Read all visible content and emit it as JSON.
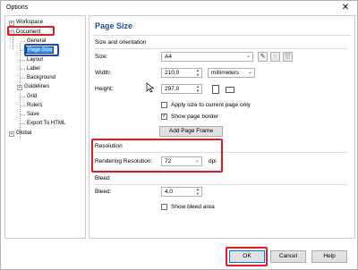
{
  "window": {
    "title": "Options",
    "close_glyph": "✕"
  },
  "tree": {
    "items": [
      {
        "label": "Workspace",
        "expander": "+"
      },
      {
        "label": "Document",
        "expander": "−"
      },
      {
        "label": "General"
      },
      {
        "label": "Page Size"
      },
      {
        "label": "Layout"
      },
      {
        "label": "Label"
      },
      {
        "label": "Background"
      },
      {
        "label": "Guidelines",
        "expander": "+"
      },
      {
        "label": "Grid"
      },
      {
        "label": "Rulers"
      },
      {
        "label": "Save"
      },
      {
        "label": "Export To HTML"
      },
      {
        "label": "Global",
        "expander": "+"
      }
    ]
  },
  "page": {
    "title": "Page Size",
    "size_orientation": {
      "section_label": "Size and orientation",
      "size_label": "Size:",
      "size_value": "A4",
      "width_label": "Width:",
      "width_value": "210,0",
      "units_value": "millimeters",
      "height_label": "Height:",
      "height_value": "297,0",
      "apply_current_label": "Apply size to current page only",
      "apply_current_checked": false,
      "show_border_label": "Show page border",
      "show_border_checked": true,
      "add_frame_label": "Add Page Frame"
    },
    "resolution": {
      "section_label": "Resolution",
      "rendering_label": "Rendering Resolution:",
      "rendering_value": "72",
      "unit": "dpi"
    },
    "bleed": {
      "section_label": "Bleed",
      "bleed_label": "Bleed:",
      "bleed_value": "4,0",
      "show_area_label": "Show bleed area",
      "show_area_checked": false
    }
  },
  "buttons": {
    "ok": "OK",
    "cancel": "Cancel",
    "help": "Help"
  },
  "glyphs": {
    "check": "✓",
    "arrow_down": "⌄",
    "spin_up": "▲",
    "spin_down": "▼"
  },
  "colors": {
    "highlight_red": "#e31b23",
    "highlight_blue": "#1e4bb8",
    "selection": "#3399ff",
    "title_blue": "#1f4e8c"
  }
}
